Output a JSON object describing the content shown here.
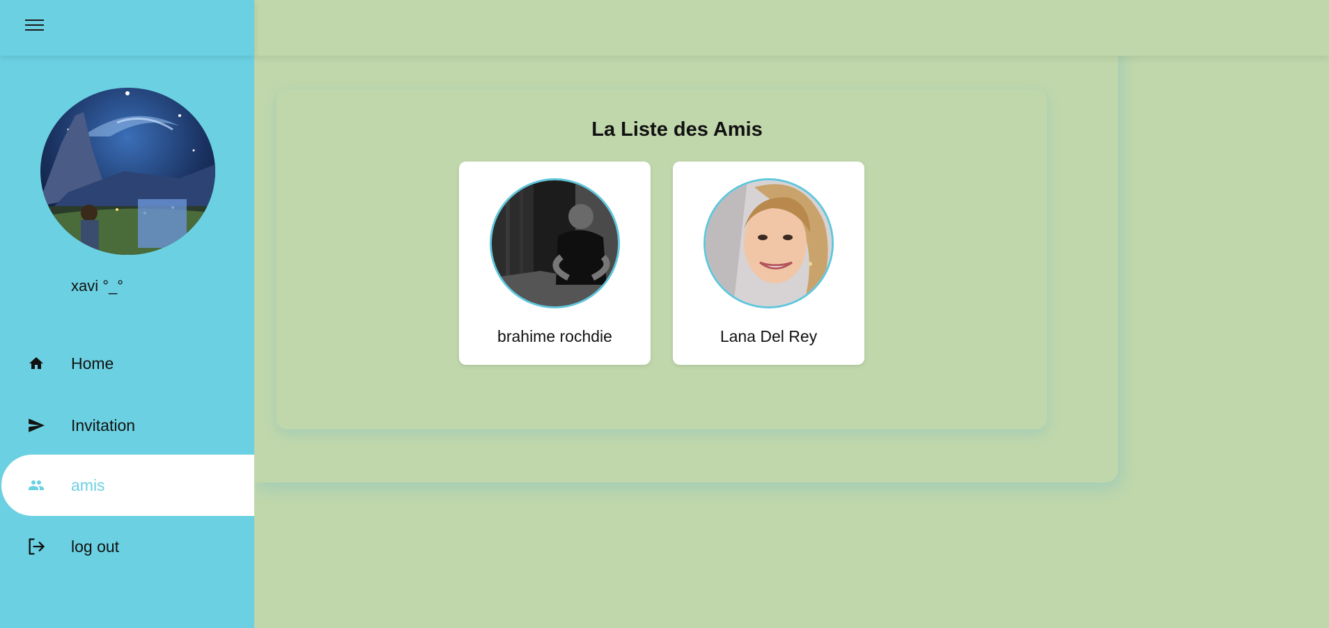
{
  "sidebar": {
    "menu_icon": "hamburger-menu-icon",
    "profile_name": "xavi °_°",
    "nav": [
      {
        "label": "Home",
        "icon": "home-icon"
      },
      {
        "label": "Invitation",
        "icon": "send-icon"
      },
      {
        "label": "amis",
        "icon": "people-icon",
        "active": true
      },
      {
        "label": "log out",
        "icon": "logout-icon"
      }
    ]
  },
  "main": {
    "title": "La Liste des Amis",
    "friends": [
      {
        "name": "brahime rochdie"
      },
      {
        "name": "Lana Del Rey"
      }
    ]
  },
  "colors": {
    "sidebar_bg": "#6bd1e2",
    "main_bg": "#c0d7ab",
    "accent": "#6bd1e2",
    "card_bg": "#ffffff"
  }
}
